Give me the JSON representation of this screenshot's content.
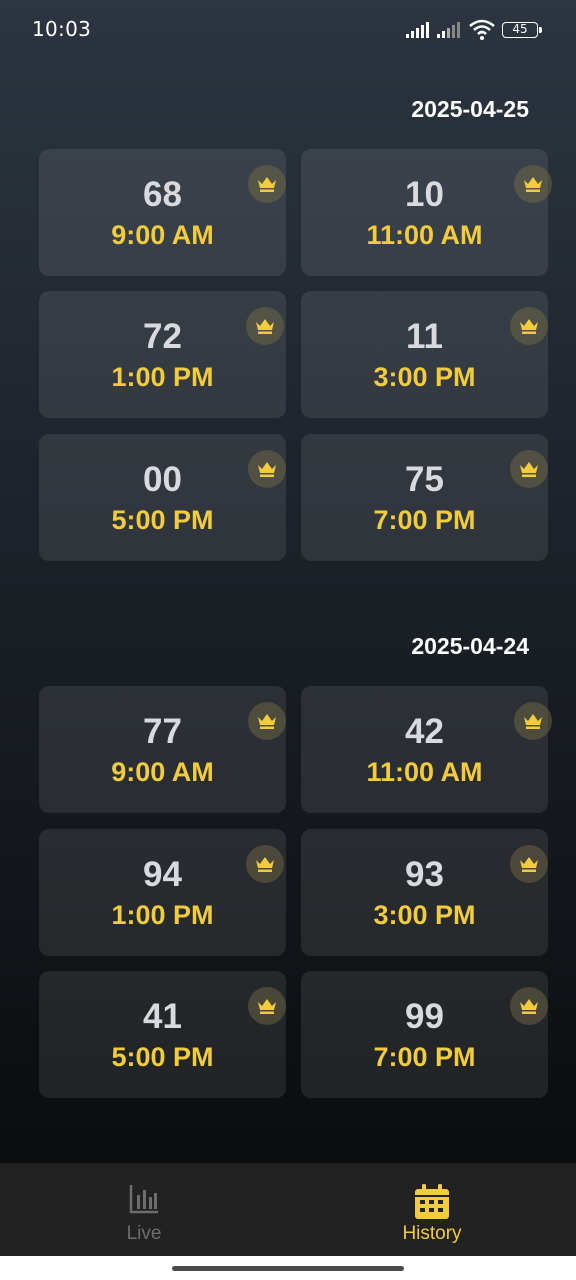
{
  "status_bar": {
    "time": "10:03",
    "battery": "45"
  },
  "sections": [
    {
      "date": "2025-04-25",
      "results": [
        {
          "number": "68",
          "time": "9:00 AM"
        },
        {
          "number": "10",
          "time": "11:00 AM"
        },
        {
          "number": "72",
          "time": "1:00 PM"
        },
        {
          "number": "11",
          "time": "3:00 PM"
        },
        {
          "number": "00",
          "time": "5:00 PM"
        },
        {
          "number": "75",
          "time": "7:00 PM"
        }
      ]
    },
    {
      "date": "2025-04-24",
      "results": [
        {
          "number": "77",
          "time": "9:00 AM"
        },
        {
          "number": "42",
          "time": "11:00 AM"
        },
        {
          "number": "94",
          "time": "1:00 PM"
        },
        {
          "number": "93",
          "time": "3:00 PM"
        },
        {
          "number": "41",
          "time": "5:00 PM"
        },
        {
          "number": "99",
          "time": "7:00 PM"
        }
      ]
    }
  ],
  "nav": {
    "live": {
      "label": "Live",
      "icon": "bar-chart-icon",
      "active": false
    },
    "history": {
      "label": "History",
      "icon": "calendar-icon",
      "active": true
    }
  },
  "colors": {
    "accent": "#f2cc3c",
    "number": "#d8dadf",
    "inactive": "#6d6d6d"
  }
}
